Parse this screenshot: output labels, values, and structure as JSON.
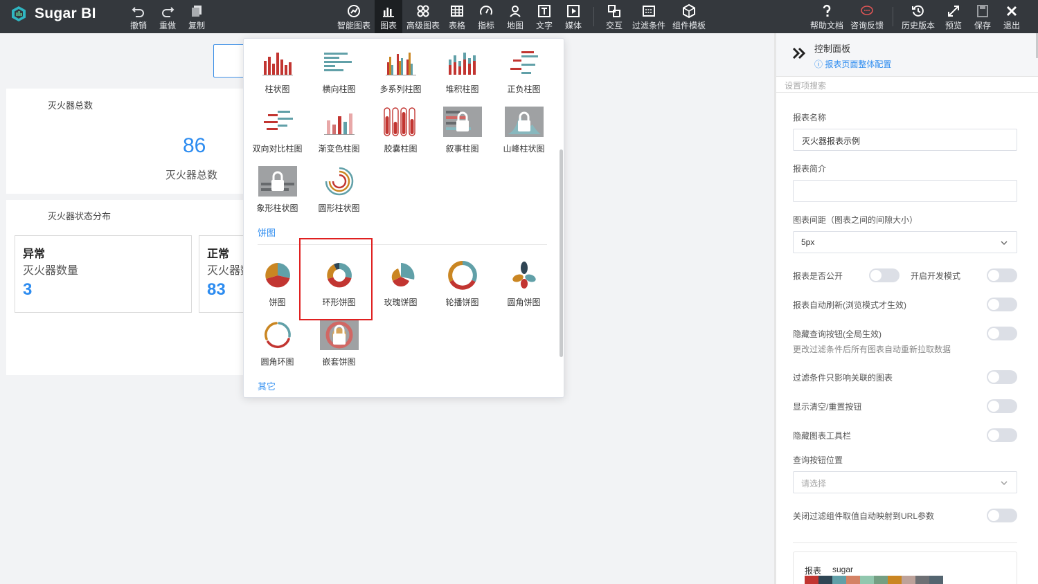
{
  "app": {
    "name": "Sugar BI"
  },
  "toolbar": {
    "undo": "撤销",
    "redo": "重做",
    "copy": "复制",
    "smart_chart": "智能图表",
    "chart": "图表",
    "advanced_chart": "高级图表",
    "table": "表格",
    "indicator": "指标",
    "map": "地图",
    "text": "文字",
    "media": "媒体",
    "interaction": "交互",
    "filter": "过滤条件",
    "component_template": "组件模板",
    "help": "帮助文档",
    "feedback": "咨询反馈",
    "history": "历史版本",
    "preview": "预览",
    "save": "保存",
    "exit": "退出"
  },
  "canvas": {
    "card1": {
      "title": "灭火器总数",
      "value": "86",
      "label": "灭火器总数"
    },
    "card2": {
      "title": "灭火器状态分布"
    },
    "stat_abnormal": {
      "head": "异常",
      "sub": "灭火器数量",
      "value": "3"
    },
    "stat_normal": {
      "head": "正常",
      "sub": "灭火器数量",
      "value": "83"
    }
  },
  "chart_menu": {
    "bar_items": [
      "柱状图",
      "横向柱图",
      "多系列柱图",
      "堆积柱图",
      "正负柱图",
      "双向对比柱图",
      "渐变色柱图",
      "胶囊柱图",
      "叙事柱图",
      "山峰柱状图",
      "象形柱状图",
      "圆形柱状图"
    ],
    "pie_section": "饼图",
    "pie_items": [
      "饼图",
      "环形饼图",
      "玫瑰饼图",
      "轮播饼图",
      "圆角饼图",
      "圆角环图",
      "嵌套饼图"
    ],
    "other_section": "其它",
    "highlighted_item": "环形饼图"
  },
  "panel": {
    "title": "控制面板",
    "page_config_link": "报表页面整体配置",
    "search_placeholder": "设置项搜索",
    "report_name_label": "报表名称",
    "report_name_value": "灭火器报表示例",
    "report_desc_label": "报表简介",
    "report_desc_value": "",
    "chart_gap_label": "图表间距（图表之间的间隙大小）",
    "chart_gap_value": "5px",
    "public_label": "报表是否公开",
    "dev_mode_label": "开启开发模式",
    "auto_refresh_label": "报表自动刷新(浏览模式才生效)",
    "hide_query_label": "隐藏查询按钮(全局生效)",
    "hide_query_hint": "更改过滤条件后所有图表自动重新拉取数据",
    "filter_related_label": "过滤条件只影响关联的图表",
    "show_reset_label": "显示清空/重置按钮",
    "hide_toolbar_label": "隐藏图表工具栏",
    "query_pos_label": "查询按钮位置",
    "query_pos_placeholder": "请选择",
    "url_param_label": "关闭过滤组件取值自动映射到URL参数",
    "theme_label_1": "报表",
    "theme_label_2": "sugar",
    "toggles": {
      "public": false,
      "dev_mode": false,
      "auto_refresh": false,
      "hide_query": false,
      "filter_related": false,
      "show_reset": false,
      "hide_toolbar": false,
      "url_param": false
    }
  },
  "colors": {
    "accent": "#2d8cf0",
    "topbar": "#34383d",
    "highlight_border": "#e02020",
    "chart_red": "#c23531",
    "chart_teal": "#61a0a8",
    "chart_orange": "#d48265",
    "chart_gold": "#ca8622",
    "theme_swatches": [
      "#c23531",
      "#2f4554",
      "#61a0a8",
      "#d48265",
      "#91c7ae",
      "#749f83",
      "#ca8622",
      "#bda29a",
      "#6e7074",
      "#546570"
    ]
  }
}
